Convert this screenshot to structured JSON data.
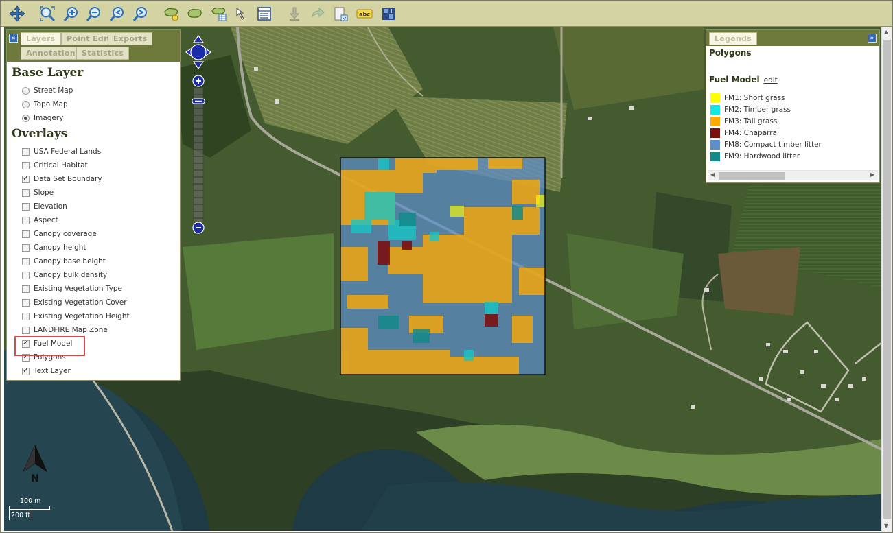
{
  "toolbar": {
    "buttons": [
      {
        "name": "pan-icon",
        "tooltip": ""
      },
      {
        "name": "zoom-extent-icon"
      },
      {
        "name": "zoom-in-icon"
      },
      {
        "name": "zoom-out-icon"
      },
      {
        "name": "zoom-previous-icon"
      },
      {
        "name": "zoom-next-icon"
      },
      {
        "name": "add-polygon-icon"
      },
      {
        "name": "edit-polygon-icon"
      },
      {
        "name": "polygon-table-icon"
      },
      {
        "name": "select-arrow-icon"
      },
      {
        "name": "attribute-table-icon"
      },
      {
        "name": "download-icon"
      },
      {
        "name": "redo-icon"
      },
      {
        "name": "export-map-icon"
      },
      {
        "name": "label-icon",
        "text": "abc"
      },
      {
        "name": "identify-icon"
      }
    ]
  },
  "left_panel": {
    "collapse_glyph": "«",
    "tabs": [
      {
        "label": "Layers",
        "active": true
      },
      {
        "label": "Point Edit",
        "active": false
      },
      {
        "label": "Exports",
        "active": false
      },
      {
        "label": "Annotation",
        "active": false
      },
      {
        "label": "Statistics",
        "active": false
      }
    ],
    "base_layer_title": "Base Layer",
    "base_layers": [
      {
        "label": "Street Map",
        "selected": false
      },
      {
        "label": "Topo Map",
        "selected": false
      },
      {
        "label": "Imagery",
        "selected": true
      }
    ],
    "overlays_title": "Overlays",
    "overlays": [
      {
        "label": "USA Federal Lands",
        "checked": false
      },
      {
        "label": "Critical Habitat",
        "checked": false
      },
      {
        "label": "Data Set Boundary",
        "checked": true
      },
      {
        "label": "Slope",
        "checked": false
      },
      {
        "label": "Elevation",
        "checked": false
      },
      {
        "label": "Aspect",
        "checked": false
      },
      {
        "label": "Canopy coverage",
        "checked": false
      },
      {
        "label": "Canopy height",
        "checked": false
      },
      {
        "label": "Canopy base height",
        "checked": false
      },
      {
        "label": "Canopy bulk density",
        "checked": false
      },
      {
        "label": "Existing Vegetation Type",
        "checked": false
      },
      {
        "label": "Existing Vegetation Cover",
        "checked": false
      },
      {
        "label": "Existing Vegetation Height",
        "checked": false
      },
      {
        "label": "LANDFIRE Map Zone",
        "checked": false
      },
      {
        "label": "Fuel Model",
        "checked": true
      },
      {
        "label": "Polygons",
        "checked": true
      },
      {
        "label": "Text Layer",
        "checked": true
      }
    ]
  },
  "right_panel": {
    "expand_glyph": "»",
    "tab_label": "Legends",
    "polygons_title": "Polygons",
    "fuel_model_title": "Fuel Model",
    "edit_link": "edit",
    "legend": [
      {
        "label": "FM1: Short grass",
        "color": "#ffff00"
      },
      {
        "label": "FM2: Timber grass",
        "color": "#15e6e6"
      },
      {
        "label": "FM3: Tall grass",
        "color": "#ffaa00"
      },
      {
        "label": "FM4: Chaparral",
        "color": "#7a0f0f"
      },
      {
        "label": "FM8: Compact timber litter",
        "color": "#5d8fcc"
      },
      {
        "label": "FM9: Hardwood litter",
        "color": "#138a8a"
      }
    ]
  },
  "map": {
    "north_label": "N",
    "scale_metric": "100 m",
    "scale_imperial": "200 ft"
  }
}
